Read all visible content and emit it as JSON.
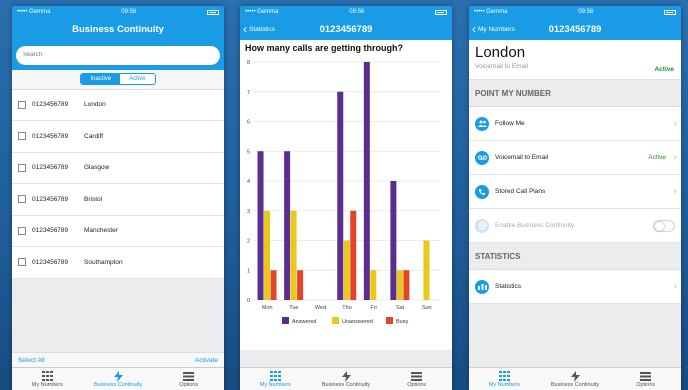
{
  "status": {
    "carrier": "••••• Gemma",
    "time": "09:56"
  },
  "screen1": {
    "title": "Business Continuity",
    "search_placeholder": "Search",
    "segments": [
      "Inactive",
      "Active"
    ],
    "rows": [
      {
        "number": "0123456789",
        "city": "London"
      },
      {
        "number": "0123456789",
        "city": "Cardiff"
      },
      {
        "number": "0123456789",
        "city": "Glasgow"
      },
      {
        "number": "0123456789",
        "city": "Bristol"
      },
      {
        "number": "0123456789",
        "city": "Manchester"
      },
      {
        "number": "0123456789",
        "city": "Southampton"
      }
    ],
    "select_all": "Select All",
    "activate": "Activate"
  },
  "tabs": {
    "my_numbers": "My Numbers",
    "business_continuity": "Business Continuity",
    "options": "Options"
  },
  "screen2": {
    "back": "Statistics",
    "title": "0123456789"
  },
  "chart_data": {
    "type": "bar",
    "title": "How many calls are getting through?",
    "categories": [
      "Mon",
      "Tue",
      "Wed",
      "Thu",
      "Fri",
      "Sat",
      "Sun"
    ],
    "series": [
      {
        "name": "Answered",
        "color": "#5b2d8e",
        "values": [
          5,
          5,
          0,
          7,
          8,
          4,
          0
        ]
      },
      {
        "name": "Unanswered",
        "color": "#e8c81a",
        "values": [
          3,
          3,
          0,
          2,
          1,
          1,
          2
        ]
      },
      {
        "name": "Busy",
        "color": "#e4452a",
        "values": [
          1,
          1,
          0,
          3,
          0,
          1,
          0
        ]
      }
    ],
    "ylim": [
      0,
      8
    ],
    "yticks": [
      0,
      1,
      2,
      3,
      4,
      5,
      6,
      7,
      8
    ],
    "grid": true,
    "legend": "bottom"
  },
  "screen3": {
    "back": "My Numbers",
    "title": "0123456789",
    "city": "London",
    "subtitle": "Voicemail to Email",
    "status": "Active",
    "section1": "POINT MY NUMBER",
    "rows": [
      {
        "label": "Follow Me",
        "icon": "people-icon"
      },
      {
        "label": "Voicemail to Email",
        "icon": "voicemail-icon",
        "status": "Active"
      },
      {
        "label": "Stored Call Plans",
        "icon": "phone-icon"
      },
      {
        "label": "Enable Business Continuity",
        "icon": "globe-icon"
      }
    ],
    "section2": "STATISTICS",
    "stats_row": "Statistics"
  }
}
